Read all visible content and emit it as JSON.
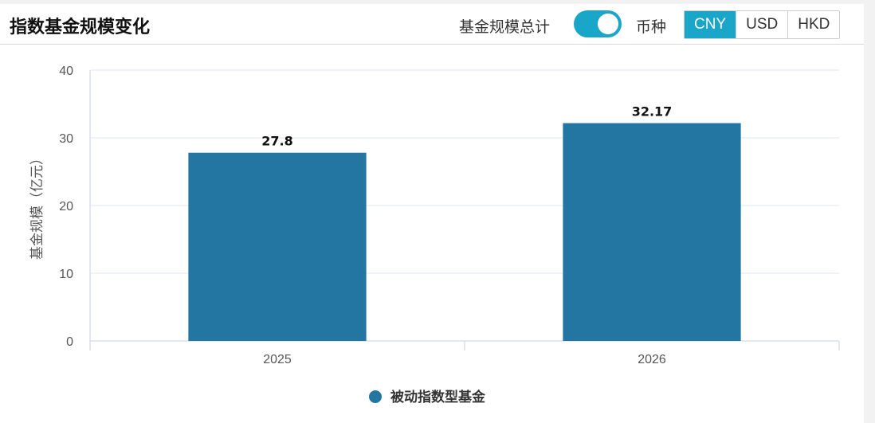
{
  "header": {
    "title": "指数基金规模变化",
    "total_label": "基金规模总计",
    "total_toggle_on": true,
    "currency_label": "币种",
    "currencies": [
      "CNY",
      "USD",
      "HKD"
    ],
    "selected_currency": "CNY"
  },
  "colors": {
    "accent": "#1aa6c8",
    "bar": "#2376a1"
  },
  "chart_data": {
    "type": "bar",
    "categories": [
      "2025",
      "2026"
    ],
    "series": [
      {
        "name": "被动指数型基金",
        "values": [
          27.8,
          32.17
        ]
      }
    ],
    "value_labels": [
      "27.8",
      "32.17"
    ],
    "ylabel": "基金规模（亿元）",
    "ylim": [
      0,
      40
    ],
    "yticks": [
      0,
      10,
      20,
      30,
      40
    ],
    "grid": true,
    "legend_position": "bottom"
  }
}
